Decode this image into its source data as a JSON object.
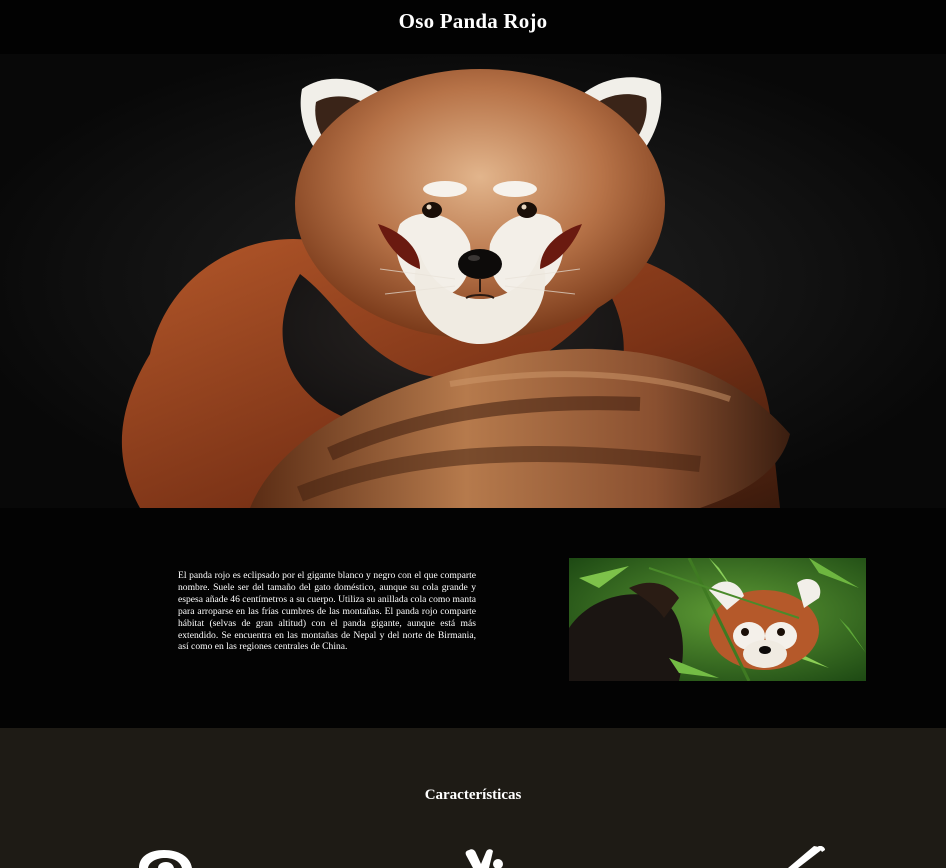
{
  "header": {
    "title": "Oso Panda Rojo"
  },
  "hero": {
    "image_subject": "red-panda-portrait"
  },
  "intro": {
    "paragraph": "El panda rojo es eclipsado por el gigante blanco y negro con el que comparte nombre. Suele ser del tamaño del gato doméstico, aunque su cola grande y espesa añade 46 centímetros a su cuerpo. Utiliza su anillada cola como manta para arroparse en las frías cumbres de las montañas. El panda rojo comparte hábitat (selvas de gran altitud) con el panda gigante, aunque está más extendido. Se encuentra en las montañas de Nepal y del norte de Birmania, así como en las regiones centrales de China.",
    "photo_subject": "red-panda-in-bamboo"
  },
  "features": {
    "title": "Características",
    "icons": [
      "ear-icon",
      "peace-hand-icon",
      "pen-icon"
    ]
  },
  "colors": {
    "header_bg": "#020202",
    "intro_bg": "#030303",
    "features_bg": "#1e1b15",
    "text": "#ffffff",
    "fur_red": "#a0471f",
    "fur_light": "#c88a5a"
  }
}
